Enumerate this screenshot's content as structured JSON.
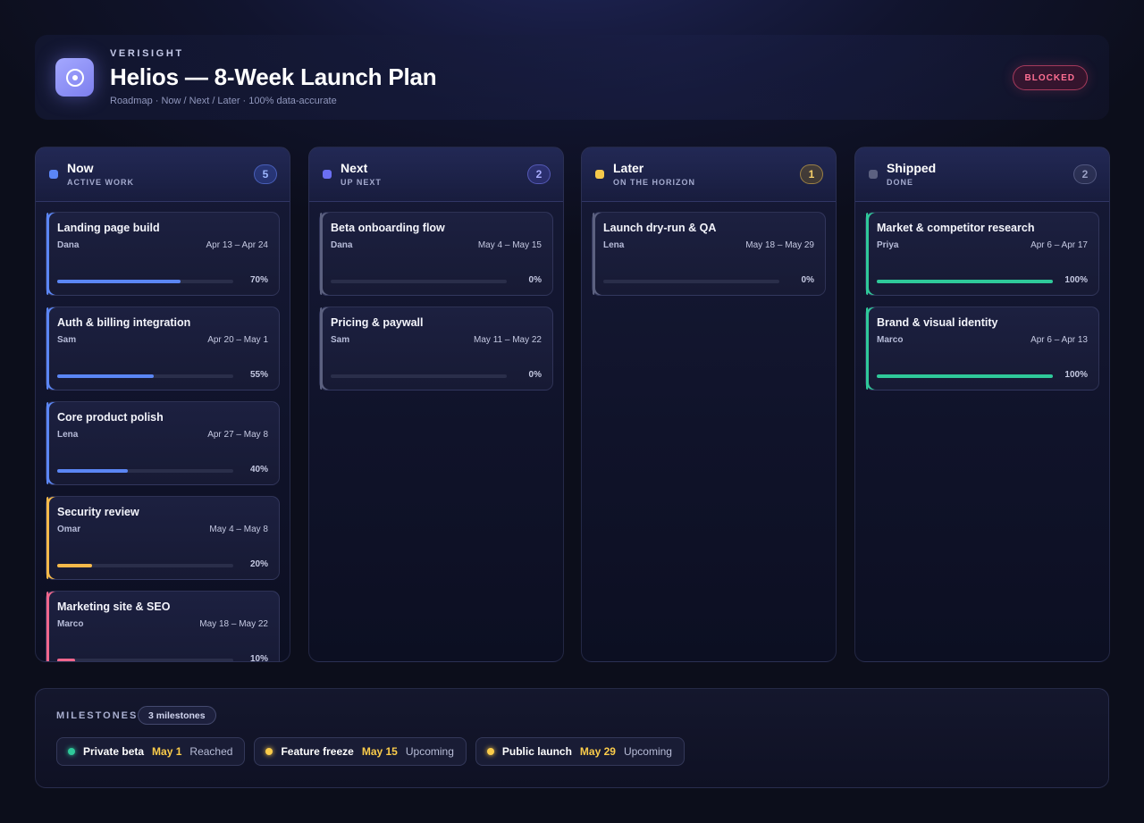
{
  "header": {
    "brand": "VERISIGHT",
    "title": "Helios — 8-Week Launch Plan",
    "subtitle": "Roadmap · Now / Next / Later · 100% data-accurate",
    "status": "BLOCKED",
    "logo_icon": "target-icon"
  },
  "colors": {
    "blue": "#5b86f5",
    "indigo": "#6b6ff2",
    "amber": "#f5b94a",
    "pink": "#f0668c",
    "green": "#2fc99a",
    "gray": "#5c6180",
    "milestone_date": "#fbcc4a"
  },
  "columns": [
    {
      "title": "Now",
      "subtitle": "ACTIVE WORK",
      "count": "5",
      "dot_color": "#5b86f5",
      "cards": [
        {
          "title": "Landing page build",
          "owner": "Dana",
          "dates": "Apr 13 – Apr 24",
          "progress": 70,
          "progress_label": "70%",
          "accent": "#5b86f5"
        },
        {
          "title": "Auth & billing integration",
          "owner": "Sam",
          "dates": "Apr 20 – May 1",
          "progress": 55,
          "progress_label": "55%",
          "accent": "#5b86f5"
        },
        {
          "title": "Core product polish",
          "owner": "Lena",
          "dates": "Apr 27 – May 8",
          "progress": 40,
          "progress_label": "40%",
          "accent": "#5b86f5"
        },
        {
          "title": "Security review",
          "owner": "Omar",
          "dates": "May 4 – May 8",
          "progress": 20,
          "progress_label": "20%",
          "accent": "#f5b94a"
        },
        {
          "title": "Marketing site & SEO",
          "owner": "Marco",
          "dates": "May 18 – May 22",
          "progress": 10,
          "progress_label": "10%",
          "accent": "#f0668c"
        }
      ]
    },
    {
      "title": "Next",
      "subtitle": "UP NEXT",
      "count": "2",
      "dot_color": "#6b6ff2",
      "cards": [
        {
          "title": "Beta onboarding flow",
          "owner": "Dana",
          "dates": "May 4 – May 15",
          "progress": 0,
          "progress_label": "0%",
          "accent": "#5c6180"
        },
        {
          "title": "Pricing & paywall",
          "owner": "Sam",
          "dates": "May 11 – May 22",
          "progress": 0,
          "progress_label": "0%",
          "accent": "#5c6180"
        }
      ]
    },
    {
      "title": "Later",
      "subtitle": "ON THE HORIZON",
      "count": "1",
      "dot_color": "#f5c94a",
      "cards": [
        {
          "title": "Launch dry-run & QA",
          "owner": "Lena",
          "dates": "May 18 – May 29",
          "progress": 0,
          "progress_label": "0%",
          "accent": "#5c6180"
        }
      ]
    },
    {
      "title": "Shipped",
      "subtitle": "DONE",
      "count": "2",
      "dot_color": "#5c6180",
      "cards": [
        {
          "title": "Market & competitor research",
          "owner": "Priya",
          "dates": "Apr 6 – Apr 17",
          "progress": 100,
          "progress_label": "100%",
          "accent": "#2fc99a"
        },
        {
          "title": "Brand & visual identity",
          "owner": "Marco",
          "dates": "Apr 6 – Apr 13",
          "progress": 100,
          "progress_label": "100%",
          "accent": "#2fc99a"
        }
      ]
    }
  ],
  "milestones": {
    "label": "MILESTONES",
    "count": "3 milestones",
    "items": [
      {
        "name": "Private beta",
        "date": "May 1",
        "status": "Reached",
        "dot_color": "#2fc99a"
      },
      {
        "name": "Feature freeze",
        "date": "May 15",
        "status": "Upcoming",
        "dot_color": "#fbcc4a"
      },
      {
        "name": "Public launch",
        "date": "May 29",
        "status": "Upcoming",
        "dot_color": "#fbcc4a"
      }
    ]
  }
}
